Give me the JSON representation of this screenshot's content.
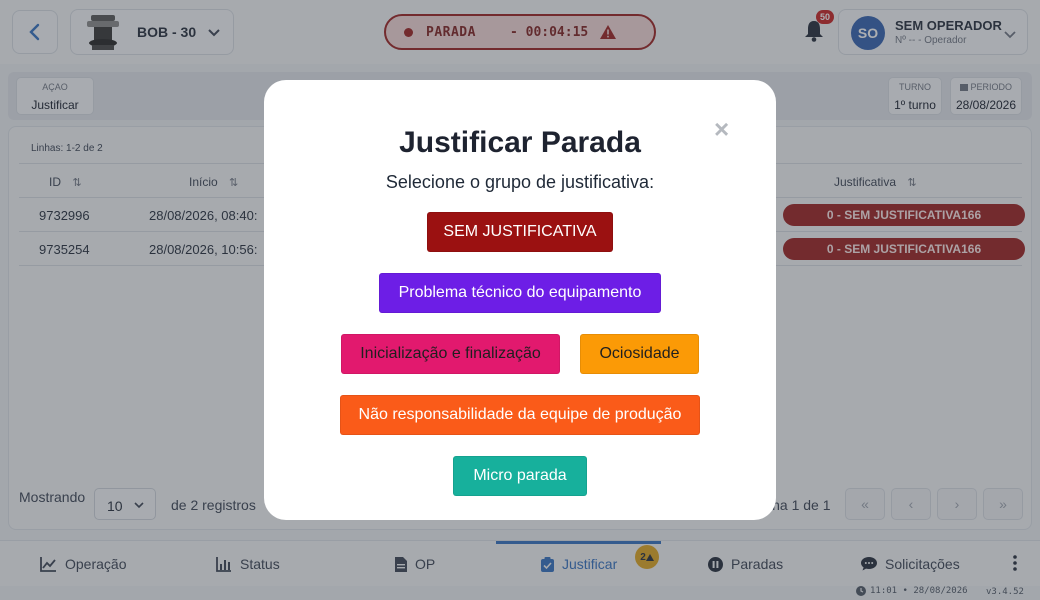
{
  "header": {
    "machine_name": "BOB - 30",
    "status_label": "PARADA",
    "status_timer": "- 00:04:15",
    "notifications_count": "50",
    "operator_initials": "SO",
    "operator_name": "SEM OPERADOR",
    "operator_number": "Nº -- - Operador"
  },
  "filters": {
    "action_label": "AÇAO",
    "action_value": "Justificar",
    "shift_label": "TURNO",
    "shift_value": "1º turno",
    "period_label": "PERIODO",
    "period_value": "28/08/2026"
  },
  "table": {
    "rows_count": "Linhas: 1-2 de 2",
    "columns": {
      "id": "ID",
      "start": "Início",
      "justification": "Justificativa"
    },
    "rows": [
      {
        "id": "9732996",
        "start": "28/08/2026, 08:40:",
        "justification": "0 - SEM JUSTIFICATIVA166"
      },
      {
        "id": "9735254",
        "start": "28/08/2026, 10:56:",
        "justification": "0 - SEM JUSTIFICATIVA166"
      }
    ]
  },
  "pagination": {
    "showing_label": "Mostrando",
    "page_size": "10",
    "records_label": "de 2 registros",
    "page_info": "ina 1 de 1"
  },
  "nav": {
    "items": [
      {
        "label": "Operação"
      },
      {
        "label": "Status"
      },
      {
        "label": "OP"
      },
      {
        "label": "Justificar"
      },
      {
        "label": "Paradas"
      },
      {
        "label": "Solicitações"
      }
    ],
    "justificar_badge": "2"
  },
  "footer": {
    "time": "11:01 • 28/08/2026",
    "version": "v3.4.52"
  },
  "modal": {
    "title": "Justificar Parada",
    "subtitle": "Selecione o grupo de justificativa:",
    "close_symbol": "×",
    "options": [
      {
        "label": "SEM JUSTIFICATIVA",
        "color": "#9b1111",
        "text_color": "#ffffff"
      },
      {
        "label": "Problema técnico do equipamento",
        "color": "#6d1ee6",
        "text_color": "#ffffff"
      },
      {
        "label": "Inicialização e finalização",
        "color": "#e2196e",
        "text_color": "#1f1f1f"
      },
      {
        "label": "Ociosidade",
        "color": "#fb9a06",
        "text_color": "#1f1f1f"
      },
      {
        "label": "Não responsabilidade da equipe de produção",
        "color": "#fa5b19",
        "text_color": "#ffffff"
      },
      {
        "label": "Micro parada",
        "color": "#17b09c",
        "text_color": "#ffffff"
      }
    ]
  },
  "colors": {
    "primary": "#2f6fc1",
    "danger": "#9b1c1c",
    "warning_badge": "#e0a61c"
  }
}
